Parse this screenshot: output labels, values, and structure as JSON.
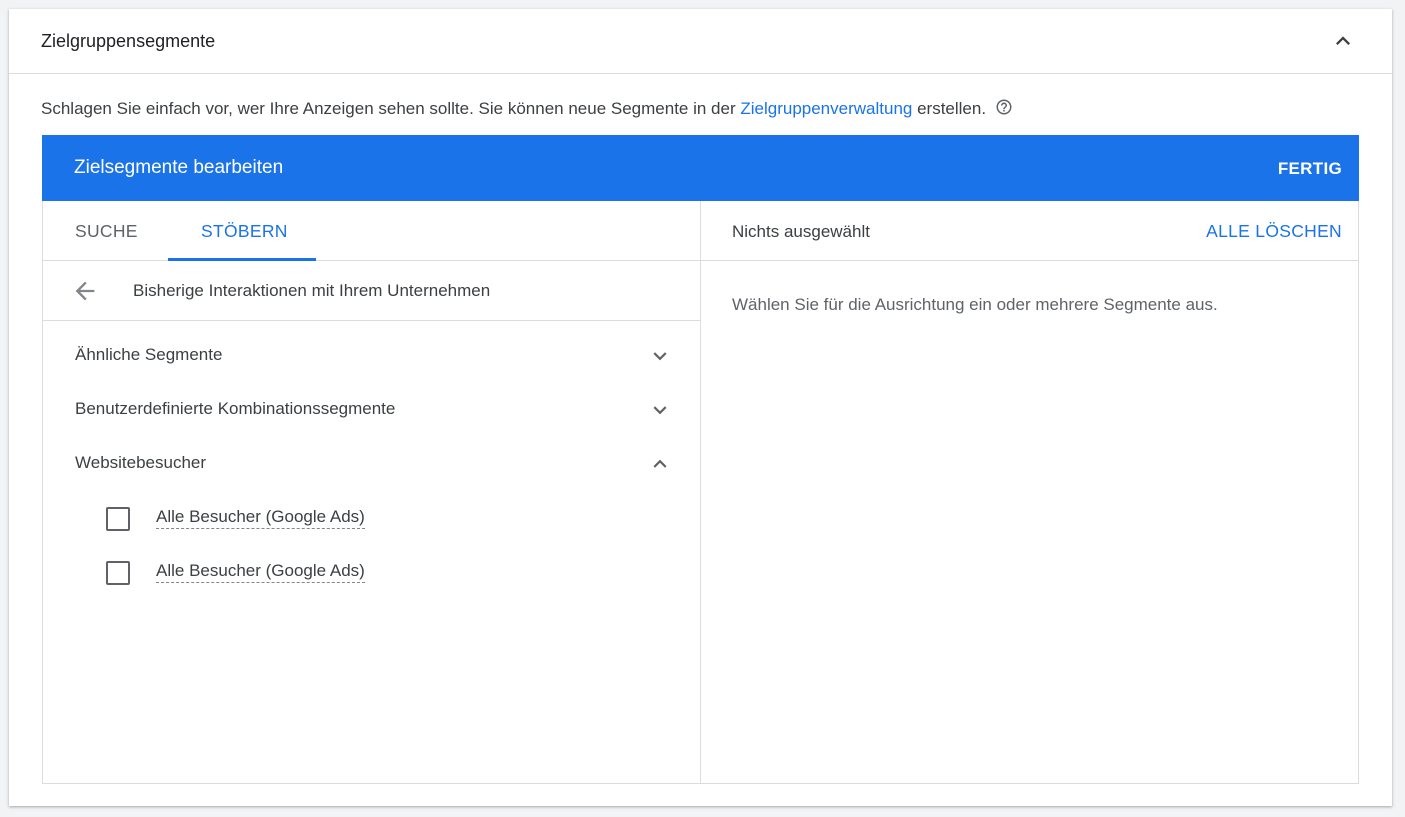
{
  "section": {
    "title": "Zielgruppensegmente",
    "collapse_icon": "chevron-up-icon"
  },
  "description": {
    "text_before": "Schlagen Sie einfach vor, wer Ihre Anzeigen sehen sollte.  Sie können neue Segmente in der ",
    "link": "Zielgruppenverwaltung",
    "text_after": " erstellen.",
    "help_icon": "help-circle-icon"
  },
  "editor": {
    "title": "Zielsegmente bearbeiten",
    "done_label": "FERTIG",
    "accent_color": "#1a73e8"
  },
  "tabs": [
    {
      "label": "SUCHE",
      "active": false
    },
    {
      "label": "STÖBERN",
      "active": true
    }
  ],
  "browse": {
    "back_icon": "arrow-back-icon",
    "breadcrumb": "Bisherige Interaktionen mit Ihrem Unternehmen",
    "categories": [
      {
        "label": "Ähnliche Segmente",
        "expanded": false
      },
      {
        "label": "Benutzerdefinierte Kombinationssegmente",
        "expanded": false
      },
      {
        "label": "Websitebesucher",
        "expanded": true
      }
    ],
    "segments": [
      {
        "label": "Alle Besucher (Google Ads)",
        "checked": false
      },
      {
        "label": "Alle Besucher (Google Ads)",
        "checked": false
      }
    ]
  },
  "selection": {
    "status": "Nichts ausgewählt",
    "clear_label": "ALLE LÖSCHEN",
    "empty_message": "Wählen Sie für die Ausrichtung ein oder mehrere Segmente aus."
  }
}
